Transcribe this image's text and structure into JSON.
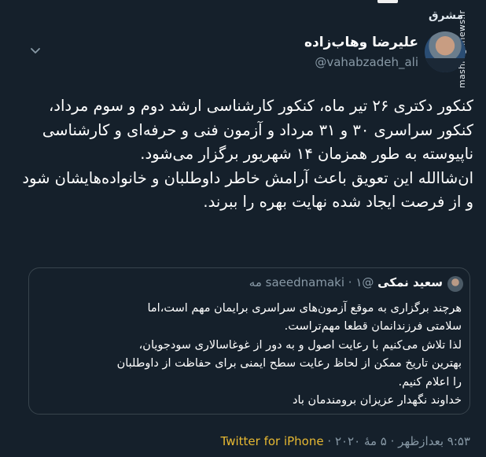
{
  "watermark": {
    "site": "mashreghnews.ir",
    "logo_text": "مشرق"
  },
  "author": {
    "name": "علیرضا وهاب‌زاده",
    "handle": "@vahabzadeh_ali"
  },
  "tweet": {
    "paragraph1": "کنکور دکتری ۲۶ تیر ماه، کنکور کارشناسی ارشد دوم و سوم مرداد، کنکور سراسری ۳۰ و ۳۱ مرداد و آزمون فنی و حرفه‌ای و کارشناسی ناپیوسته به طور همزمان ۱۴ شهریور برگزار می‌شود.",
    "paragraph2": "ان‌شاالله این تعویق باعث آرامش خاطر داوطلبان و خانواده‌هایشان شود و از فرصت ایجاد شده نهایت بهره را ببرند."
  },
  "quoted": {
    "name": "سعید نمکی",
    "handle": "@saeednamaki",
    "date": "۱ مه",
    "lines": [
      "هرچند برگزاری به موقع آزمون‌های سراسری برایمان مهم است،اما",
      "سلامتی فرزندانمان قطعا مهم‌تراست.",
      "لذا تلاش می‌کنیم با رعایت اصول و به دور از غوغاسالاری سودجویان،",
      "بهترین تاریخ ممکن از لحاظ رعایت سطح ایمنی برای حفاظت از داوطلبان",
      "را اعلام کنیم.",
      "خداوند نگهدار عزیزان برومندمان باد"
    ]
  },
  "footer": {
    "time": "۹:۵۳ بعدازظهر · ۵ مهٔ ۲۰۲۰ ·",
    "app": "Twitter for iPhone"
  },
  "colors": {
    "background": "#15202b",
    "secondary_text": "#8899a6",
    "border": "#38444d",
    "app_link": "#e6b832"
  }
}
